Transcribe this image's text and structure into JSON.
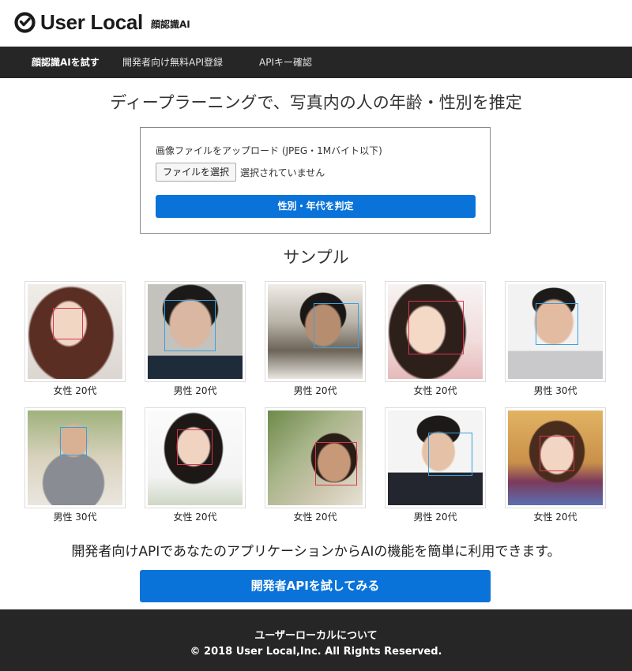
{
  "header": {
    "logo_text": "User Local",
    "logo_sub": "顔認識AI"
  },
  "nav": {
    "items": [
      {
        "label": "顔認識AIを試す"
      },
      {
        "label": "開発者向け無料API登録"
      },
      {
        "label": "APIキー確認"
      }
    ]
  },
  "main": {
    "headline": "ディープラーニングで、写真内の人の年齢・性別を推定",
    "upload": {
      "label": "画像ファイルをアップロード (JPEG・1Mバイト以下)",
      "file_button": "ファイルを選択",
      "file_status": "選択されていません",
      "submit": "性別・年代を判定"
    },
    "sample_title": "サンプル",
    "samples": [
      {
        "caption": "女性 20代",
        "gender": "female"
      },
      {
        "caption": "男性 20代",
        "gender": "male"
      },
      {
        "caption": "男性 20代",
        "gender": "male"
      },
      {
        "caption": "女性 20代",
        "gender": "female"
      },
      {
        "caption": "男性 30代",
        "gender": "male"
      },
      {
        "caption": "男性 30代",
        "gender": "male"
      },
      {
        "caption": "女性 20代",
        "gender": "female"
      },
      {
        "caption": "女性 20代",
        "gender": "female"
      },
      {
        "caption": "男性 20代",
        "gender": "male"
      },
      {
        "caption": "女性 20代",
        "gender": "female"
      }
    ],
    "dev_text": "開発者向けAPIであなたのアプリケーションからAIの機能を簡単に利用できます。",
    "dev_button": "開発者APIを試してみる"
  },
  "footer": {
    "link": "ユーザーローカルについて",
    "copyright": "© 2018 User Local,Inc. All Rights Reserved."
  },
  "colors": {
    "accent": "#0a73d9",
    "dark_bar": "#262626",
    "male_box": "#3aa0e0",
    "female_box": "#d9364f"
  }
}
